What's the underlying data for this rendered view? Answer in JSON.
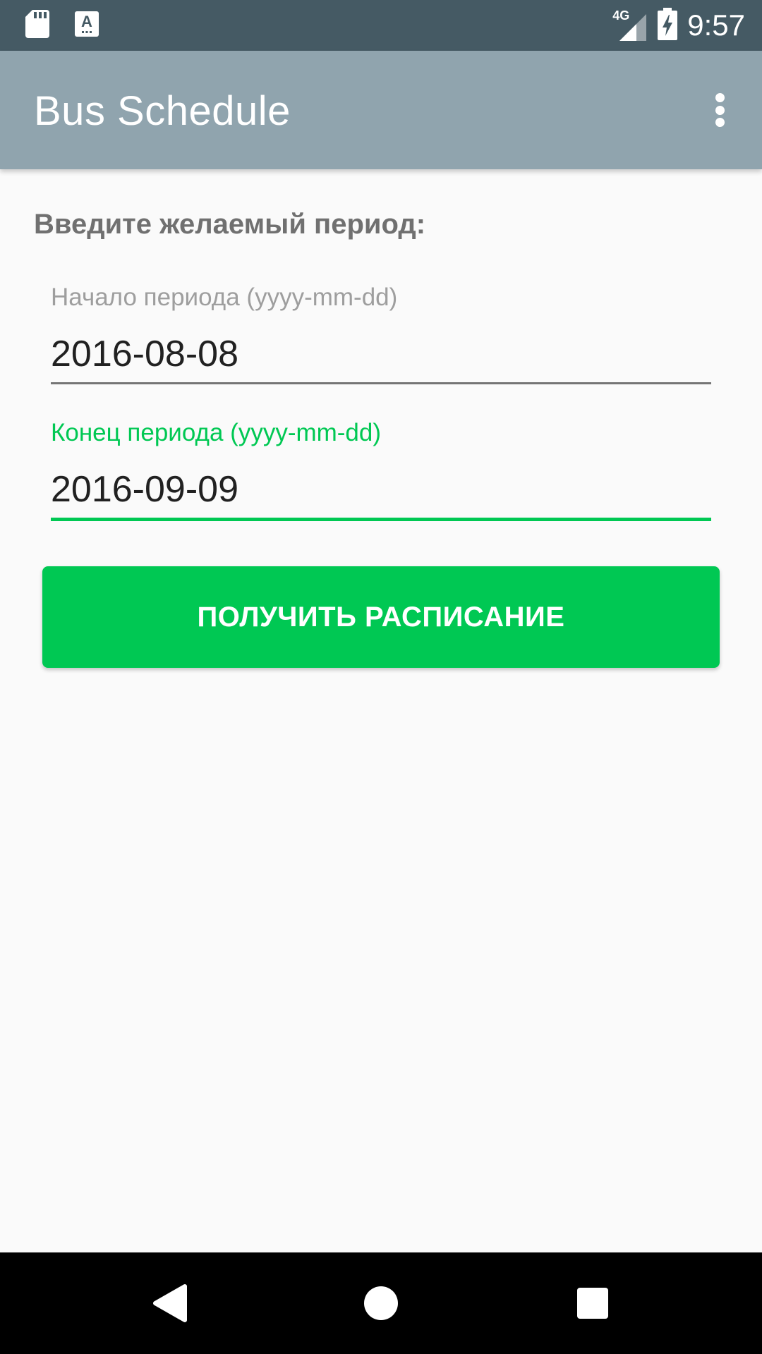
{
  "status_bar": {
    "left_icons": [
      "sd-card-icon",
      "keyboard-a-icon"
    ],
    "network_label": "4G",
    "right_icons": [
      "signal-icon",
      "battery-charging-icon"
    ],
    "time": "9:57"
  },
  "app_bar": {
    "title": "Bus Schedule",
    "menu_icon": "overflow-menu-icon"
  },
  "form": {
    "prompt": "Введите желаемый период:",
    "start_field": {
      "label": "Начало периода (yyyy-mm-dd)",
      "value": "2016-08-08",
      "focused": false
    },
    "end_field": {
      "label": "Конец периода (yyyy-mm-dd)",
      "value": "2016-09-09",
      "focused": true
    },
    "submit_label": "ПОЛУЧИТЬ РАСПИСАНИЕ"
  },
  "nav_bar": {
    "buttons": [
      "back-icon",
      "home-icon",
      "recents-icon"
    ]
  },
  "colors": {
    "status_bar": "#455A64",
    "app_bar": "#90A4AE",
    "accent": "#00C853",
    "background": "#FAFAFA"
  }
}
